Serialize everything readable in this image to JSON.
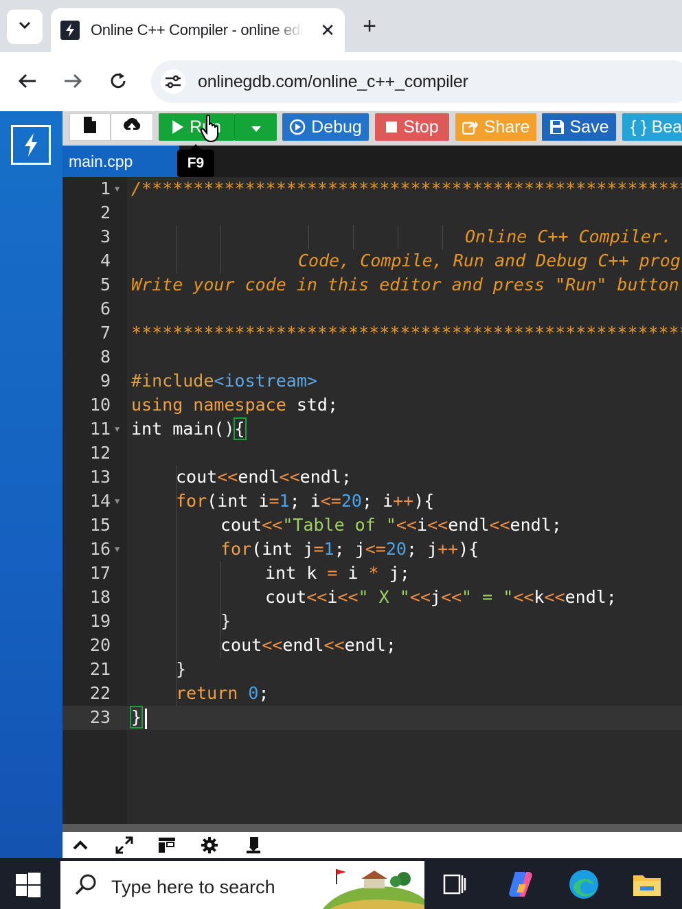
{
  "browser": {
    "tab_title": "Online C++ Compiler - online editor",
    "new_tab_label": "+",
    "close_label": "✕",
    "url": "onlinegdb.com/online_c++_compiler"
  },
  "toolbar": {
    "run_label": "Run",
    "debug_label": "Debug",
    "stop_label": "Stop",
    "share_label": "Share",
    "save_label": "Save",
    "beautify_label": "{ } Beautify",
    "run_tooltip": "F9"
  },
  "editor": {
    "file_tab": "main.cpp",
    "line_numbers": [
      "1",
      "2",
      "3",
      "4",
      "5",
      "6",
      "7",
      "8",
      "9",
      "10",
      "11",
      "12",
      "13",
      "14",
      "15",
      "16",
      "17",
      "18",
      "19",
      "20",
      "21",
      "22",
      "23"
    ],
    "code": {
      "l1": "/******************************************************************************",
      "l3": "Online C++ Compiler.",
      "l4": "Code, Compile, Run and Debug C++ program online.",
      "l5": "Write your code in this editor and press \"Run\" button to compile and execute it.",
      "l7": "*******************************************************************************/",
      "l9_kw": "#include",
      "l9_hdr": "<iostream>",
      "l10_kw": "using namespace",
      "l10_rest": " std;",
      "l11": "int main()",
      "l11_brace": "{",
      "l13_a": "cout",
      "l13_b": "<<",
      "l13_c": "endl",
      "l13_d": "<<",
      "l13_e": "endl;",
      "l14_for": "for",
      "l14_a": "(int i",
      "l14_eq": "=",
      "l14_1": "1",
      "l14_b": "; i",
      "l14_le": "<=",
      "l14_20": "20",
      "l14_c": "; i",
      "l14_pp": "++",
      "l14_d": "){",
      "l15_a": "cout",
      "l15_op": "<<",
      "l15_str": "\"Table of \"",
      "l15_b": "<<",
      "l15_c": "i",
      "l15_d": "<<",
      "l15_e": "endl",
      "l15_f": "<<",
      "l15_g": "endl;",
      "l16_for": "for",
      "l16_a": "(int j",
      "l16_eq": "=",
      "l16_1": "1",
      "l16_b": "; j",
      "l16_le": "<=",
      "l16_20": "20",
      "l16_c": "; j",
      "l16_pp": "++",
      "l16_d": "){",
      "l17_a": "int k ",
      "l17_eq": "=",
      "l17_b": " i ",
      "l17_mul": "*",
      "l17_c": " j;",
      "l18_a": "cout",
      "l18_o1": "<<",
      "l18_b": "i",
      "l18_o2": "<<",
      "l18_s1": "\" X \"",
      "l18_o3": "<<",
      "l18_c": "j",
      "l18_o4": "<<",
      "l18_s2": "\" = \"",
      "l18_o5": "<<",
      "l18_d": "k",
      "l18_o6": "<<",
      "l18_e": "endl;",
      "l19": "}",
      "l20_a": "cout",
      "l20_o1": "<<",
      "l20_b": "endl",
      "l20_o2": "<<",
      "l20_c": "endl;",
      "l21": "}",
      "l22_kw": "return",
      "l22_num": "0",
      "l22_end": ";",
      "l23": "}"
    }
  },
  "taskbar": {
    "search_placeholder": "Type here to search"
  },
  "colors": {
    "run_green": "#13a538",
    "debug_blue": "#2273c9",
    "stop_red": "#df5959",
    "share_orange": "#f4a02c",
    "save_blue": "#1f66be",
    "beautify_cyan": "#24a3d9",
    "comment_orange": "#e8961e"
  },
  "icons": [
    "chevron-down-icon",
    "lightning-icon",
    "close-icon",
    "plus-icon",
    "back-icon",
    "forward-icon",
    "reload-icon",
    "site-info-icon",
    "new-file-icon",
    "upload-icon",
    "play-icon",
    "dropdown-icon",
    "debug-icon",
    "stop-icon",
    "share-icon",
    "save-icon",
    "mouse-cursor-icon",
    "chevron-up-icon",
    "expand-icon",
    "layout-icon",
    "gear-icon",
    "download-icon",
    "windows-start-icon",
    "search-icon",
    "task-view-icon",
    "copilot-icon",
    "edge-icon",
    "file-explorer-icon"
  ]
}
